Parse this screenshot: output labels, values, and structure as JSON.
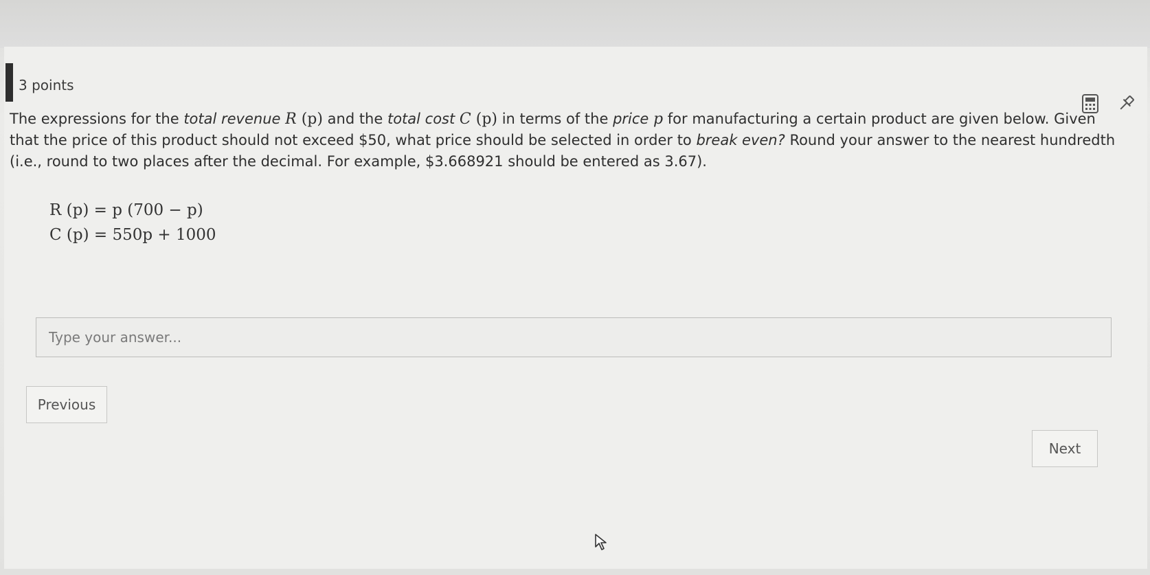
{
  "question": {
    "points_label": "3 points",
    "text_1": "The expressions for the ",
    "em_revenue": "total revenue",
    "math_R": "R",
    "math_p_paren": "(p)",
    "text_2": " and the ",
    "em_cost": "total cost",
    "math_C": "C",
    "text_3": " in terms of the ",
    "em_price": "price",
    "math_p": "p",
    "text_4": " for manufacturing a certain product are given below. Given that the price of this product should not exceed $50, what price should be selected in order to ",
    "em_break_even": "break even?",
    "text_5": " Round your answer to the nearest hundredth (i.e., round to two places after the decimal. For example, $3.668921 should be entered as 3.67).",
    "equation_revenue": "R (p) = p (700 − p)",
    "equation_cost": "C (p) = 550p + 1000"
  },
  "answer": {
    "placeholder": "Type your answer...",
    "value": ""
  },
  "navigation": {
    "previous_label": "Previous",
    "next_label": "Next"
  },
  "icons": {
    "calculator": "calculator-icon",
    "pin": "pin-icon",
    "cursor": "mouse-cursor-icon"
  }
}
